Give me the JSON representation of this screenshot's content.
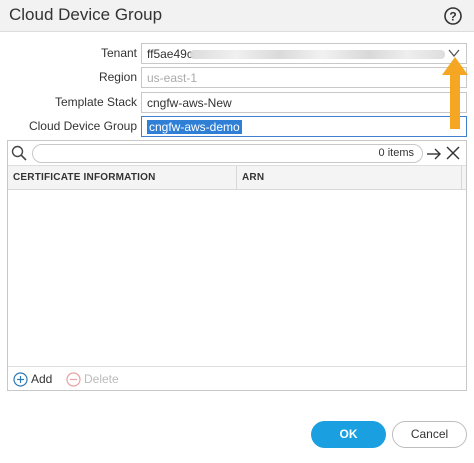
{
  "dialog": {
    "title": "Cloud Device Group",
    "help_icon": "question-circle-icon"
  },
  "form": {
    "tenant": {
      "label": "Tenant",
      "value": "ff5ae49c"
    },
    "region": {
      "label": "Region",
      "value": "us-east-1"
    },
    "template_stack": {
      "label": "Template Stack",
      "value": "cngfw-aws-New"
    },
    "cloud_device_group": {
      "label": "Cloud Device Group",
      "value": "cngfw-aws-demo"
    }
  },
  "grid": {
    "search": {
      "count_text": "0 items"
    },
    "columns": [
      "CERTIFICATE INFORMATION",
      "ARN"
    ],
    "rows": [],
    "footer": {
      "add_label": "Add",
      "delete_label": "Delete"
    }
  },
  "buttons": {
    "ok": "OK",
    "cancel": "Cancel"
  },
  "colors": {
    "primary_button": "#1aa0e0",
    "selection": "#2f7fd6",
    "annotation_arrow": "#f5a623"
  }
}
